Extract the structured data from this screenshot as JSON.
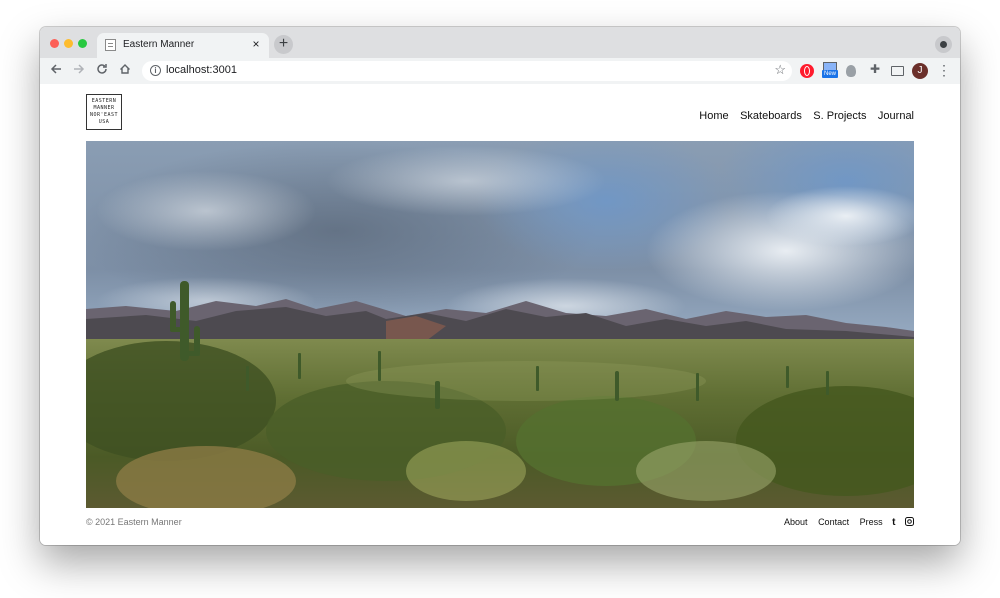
{
  "browser": {
    "tab_title": "Eastern Manner",
    "tab_close": "×",
    "new_tab": "+",
    "url": "localhost:3001",
    "extension_badge": "New",
    "profile_initial": "J"
  },
  "site": {
    "logo_lines": [
      "EASTERN",
      "MANNER",
      "NOR'EAST",
      "USA"
    ],
    "nav": [
      "Home",
      "Skateboards",
      "S. Projects",
      "Journal"
    ],
    "copyright": "© 2021 Eastern Manner",
    "footer_links": [
      "About",
      "Contact",
      "Press"
    ],
    "social_icons": [
      "tumblr-icon",
      "instagram-icon"
    ]
  }
}
